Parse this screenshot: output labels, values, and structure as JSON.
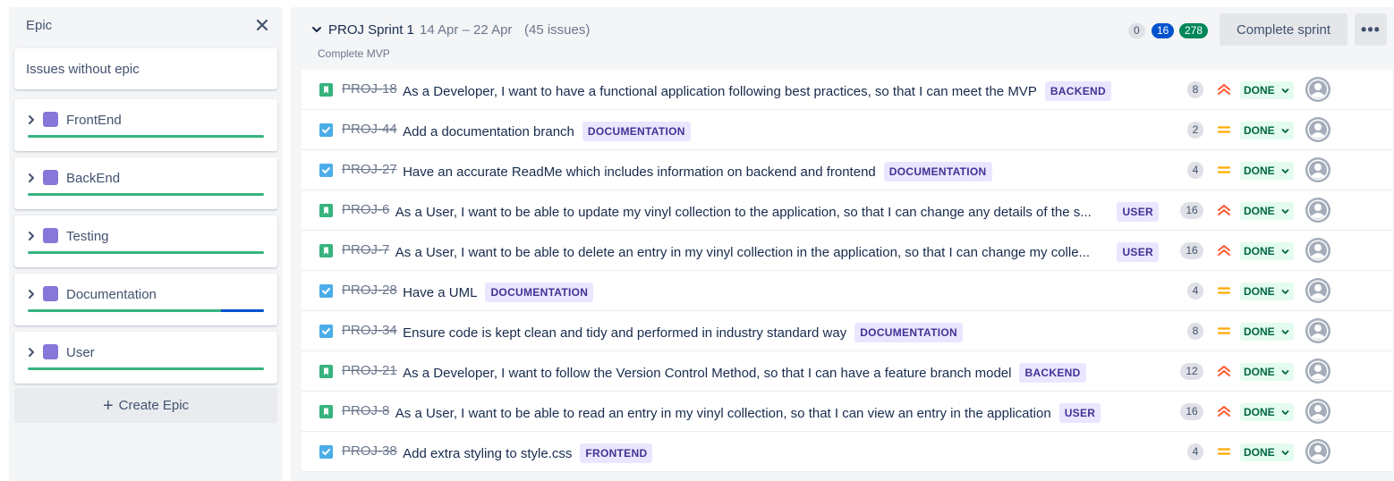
{
  "epic_panel": {
    "title": "Epic",
    "no_epic_label": "Issues without epic",
    "epics": [
      {
        "name": "FrontEnd",
        "color": "#8777d9",
        "done_fraction": 1.0,
        "in_progress_fraction": 0.0
      },
      {
        "name": "BackEnd",
        "color": "#8777d9",
        "done_fraction": 1.0,
        "in_progress_fraction": 0.0
      },
      {
        "name": "Testing",
        "color": "#8777d9",
        "done_fraction": 1.0,
        "in_progress_fraction": 0.0
      },
      {
        "name": "Documentation",
        "color": "#8777d9",
        "done_fraction": 0.82,
        "in_progress_fraction": 0.18
      },
      {
        "name": "User",
        "color": "#8777d9",
        "done_fraction": 1.0,
        "in_progress_fraction": 0.0
      }
    ],
    "create_label": "Create Epic"
  },
  "sprint": {
    "name": "PROJ Sprint 1",
    "dates": "14 Apr – 22 Apr",
    "issue_count": "(45 issues)",
    "goal": "Complete MVP",
    "counts": {
      "todo": "0",
      "in_progress": "16",
      "done": "278"
    },
    "complete_label": "Complete sprint",
    "more_label": "•••"
  },
  "colors": {
    "story": "#36b37e",
    "task": "#4bade8",
    "done_bar": "#36b37e",
    "in_progress_bar": "#0052cc",
    "priority_high": "#ff5630",
    "priority_medium": "#ffab00"
  },
  "issues": [
    {
      "key": "PROJ-18",
      "type": "story",
      "summary": "As a Developer, I want to have a functional application following best practices, so that I can meet the MVP",
      "epic": "BACKEND",
      "estimate": "8",
      "priority": "high",
      "status": "DONE"
    },
    {
      "key": "PROJ-44",
      "type": "task",
      "summary": "Add a documentation branch",
      "epic": "DOCUMENTATION",
      "estimate": "2",
      "priority": "medium",
      "status": "DONE"
    },
    {
      "key": "PROJ-27",
      "type": "task",
      "summary": "Have an accurate ReadMe which includes information on backend and frontend",
      "epic": "DOCUMENTATION",
      "estimate": "4",
      "priority": "medium",
      "status": "DONE"
    },
    {
      "key": "PROJ-6",
      "type": "story",
      "summary": "As a User, I want to be able to update my vinyl collection to the application, so that I can change any details of the s...",
      "epic": "USER",
      "estimate": "16",
      "priority": "high",
      "status": "DONE"
    },
    {
      "key": "PROJ-7",
      "type": "story",
      "summary": "As a User, I want to be able to delete an entry in my vinyl collection in the application, so that I can change my colle...",
      "epic": "USER",
      "estimate": "16",
      "priority": "high",
      "status": "DONE"
    },
    {
      "key": "PROJ-28",
      "type": "task",
      "summary": "Have a UML",
      "epic": "DOCUMENTATION",
      "estimate": "4",
      "priority": "medium",
      "status": "DONE"
    },
    {
      "key": "PROJ-34",
      "type": "task",
      "summary": "Ensure code is kept clean and tidy and performed in industry standard way",
      "epic": "DOCUMENTATION",
      "estimate": "8",
      "priority": "medium",
      "status": "DONE"
    },
    {
      "key": "PROJ-21",
      "type": "story",
      "summary": "As a Developer, I want to follow the Version Control Method, so that I can have a feature branch model",
      "epic": "BACKEND",
      "estimate": "12",
      "priority": "high",
      "status": "DONE"
    },
    {
      "key": "PROJ-8",
      "type": "story",
      "summary": "As a User, I want to be able to read an entry in my vinyl collection, so that I can view an entry in the application",
      "epic": "USER",
      "estimate": "16",
      "priority": "high",
      "status": "DONE"
    },
    {
      "key": "PROJ-38",
      "type": "task",
      "summary": "Add extra styling to style.css",
      "epic": "FRONTEND",
      "estimate": "4",
      "priority": "medium",
      "status": "DONE"
    }
  ]
}
